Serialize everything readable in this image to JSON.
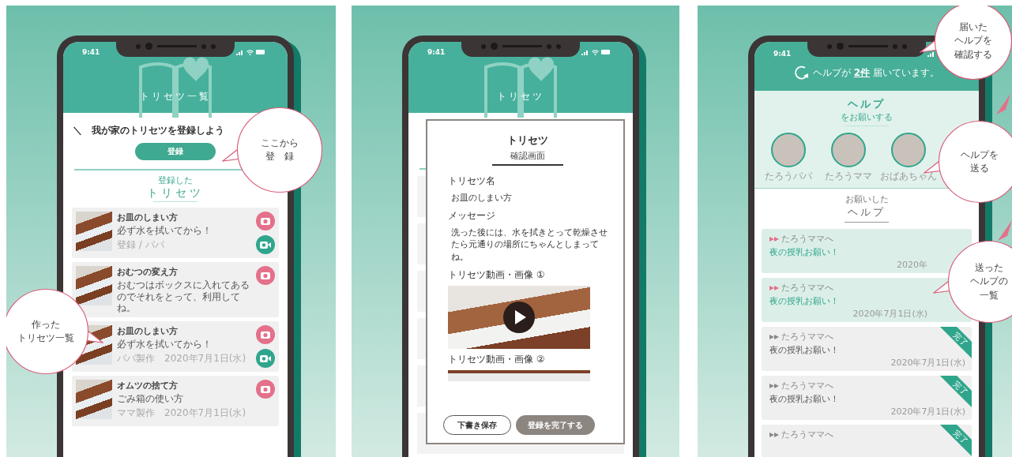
{
  "screen_list": {
    "status_time": "9:41",
    "header_title": "トリセツ一覧",
    "intro": "＼　我が家のトリセツを登録しよう",
    "register_button": "登録",
    "section_caption": "登録した",
    "section_title": "トリセツ",
    "items": [
      {
        "title": "お皿のしまい方",
        "description": "必ず水を拭いてから！",
        "meta": "登録 / パパ",
        "has_video": true
      },
      {
        "title": "おむつの変え方",
        "description": "おむつはボックスに入れてあるのでそれをとって、利用してね。",
        "has_video": false
      },
      {
        "title": "お皿のしまい方",
        "description": "必ず水を拭いてから！",
        "meta": "パパ製作　2020年7月1日(水)",
        "has_video": true
      },
      {
        "title": "オムツの捨て方",
        "description": "ごみ箱の使い方",
        "meta": "ママ製作　2020年7月1日(水)",
        "has_video": false
      }
    ],
    "callouts": [
      {
        "lines": [
          "ここから",
          "登　録"
        ]
      },
      {
        "lines": [
          "作った",
          "トリセツ一覧"
        ]
      }
    ]
  },
  "screen_confirm": {
    "status_time": "9:41",
    "header_title": "トリセツ",
    "dialog": {
      "title": "トリセツ",
      "subtitle": "確認画面",
      "fields": [
        {
          "label": "トリセツ名",
          "value": "お皿のしまい方"
        },
        {
          "label": "メッセージ",
          "value": "洗った後には、水を拭きとって乾燥させたら元通りの場所にちゃんとしまってね。"
        }
      ],
      "media": [
        {
          "label": "トリセツ動画・画像 ①",
          "kind": "video"
        },
        {
          "label": "トリセツ動画・画像 ②",
          "kind": "image"
        }
      ],
      "buttons": [
        {
          "label": "下書き保存",
          "kind": "outline"
        },
        {
          "label": "登録を完了する",
          "kind": "filled"
        }
      ]
    }
  },
  "screen_help": {
    "status_time": "9:41",
    "notice": "ヘルプが **2件** 届いています。",
    "request_title": "ヘルプ",
    "request_caption": "をお願いする",
    "people": [
      {
        "name": "たろうパパ"
      },
      {
        "name": "たろうママ"
      },
      {
        "name": "おばあちゃん"
      }
    ],
    "sent_caption": "お願いした",
    "sent_title": "ヘルプ",
    "items": [
      {
        "to": "たろうママへ",
        "title": "夜の授乳お願い！",
        "date": "2020年",
        "done": false
      },
      {
        "to": "たろうママへ",
        "title": "夜の授乳お願い！",
        "date": "2020年7月1日(水)",
        "done": false
      },
      {
        "to": "たろうママへ",
        "title": "夜の授乳お願い！",
        "date": "2020年7月1日(水)",
        "done": true,
        "badge": "完了"
      },
      {
        "to": "たろうママへ",
        "title": "夜の授乳お願い！",
        "date": "2020年7月1日(水)",
        "done": true,
        "badge": "完了"
      },
      {
        "to": "たろうママへ",
        "done": true,
        "badge": "完了"
      }
    ],
    "callouts": [
      {
        "lines": [
          "届いた",
          "ヘルプを",
          "確認する"
        ]
      },
      {
        "lines": [
          "ヘルプを",
          "送る"
        ]
      },
      {
        "lines": [
          "送った",
          "ヘルプの",
          "一覧"
        ]
      }
    ]
  }
}
